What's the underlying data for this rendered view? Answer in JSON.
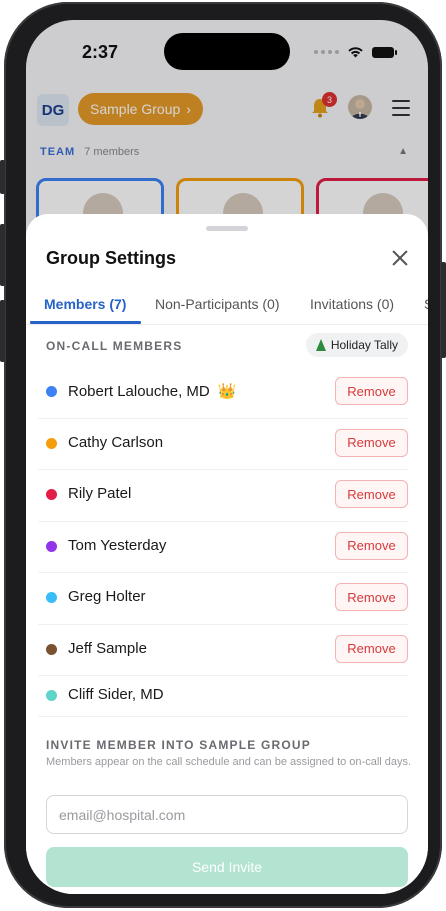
{
  "status_bar": {
    "time": "2:37"
  },
  "app_header": {
    "logo_text": "DG",
    "group_name": "Sample Group",
    "group_chevron": "›",
    "notification_count": "3"
  },
  "team": {
    "label": "TEAM",
    "count": "7 members",
    "toggle": "▲"
  },
  "sheet": {
    "title": "Group Settings",
    "tabs": [
      {
        "label": "Members (7)"
      },
      {
        "label": "Non-Participants (0)"
      },
      {
        "label": "Invitations (0)"
      },
      {
        "label": "S"
      }
    ],
    "section_title": "ON-CALL MEMBERS",
    "holiday_button": "Holiday Tally",
    "members": [
      {
        "name": "Robert Lalouche, MD",
        "color": "#3b82f6",
        "crown": "👑",
        "remove": "Remove"
      },
      {
        "name": "Cathy Carlson",
        "color": "#f59e0b",
        "remove": "Remove"
      },
      {
        "name": "Rily Patel",
        "color": "#e11d48",
        "remove": "Remove"
      },
      {
        "name": "Tom Yesterday",
        "color": "#9333ea",
        "remove": "Remove"
      },
      {
        "name": "Greg Holter",
        "color": "#38bdf8",
        "remove": "Remove"
      },
      {
        "name": "Jeff Sample",
        "color": "#7a5230",
        "remove": "Remove"
      },
      {
        "name": "Cliff Sider, MD",
        "color": "#5ed3c8"
      }
    ],
    "invite": {
      "title": "INVITE MEMBER INTO SAMPLE GROUP",
      "help": "Members appear on the call schedule and can be assigned to on-call days.",
      "placeholder": "email@hospital.com",
      "button": "Send Invite"
    }
  },
  "colors": {
    "accent": "#2563c9",
    "group_pill": "#e69a2a",
    "remove_text": "#d63a3a",
    "send_button": "#b3e4d1"
  }
}
